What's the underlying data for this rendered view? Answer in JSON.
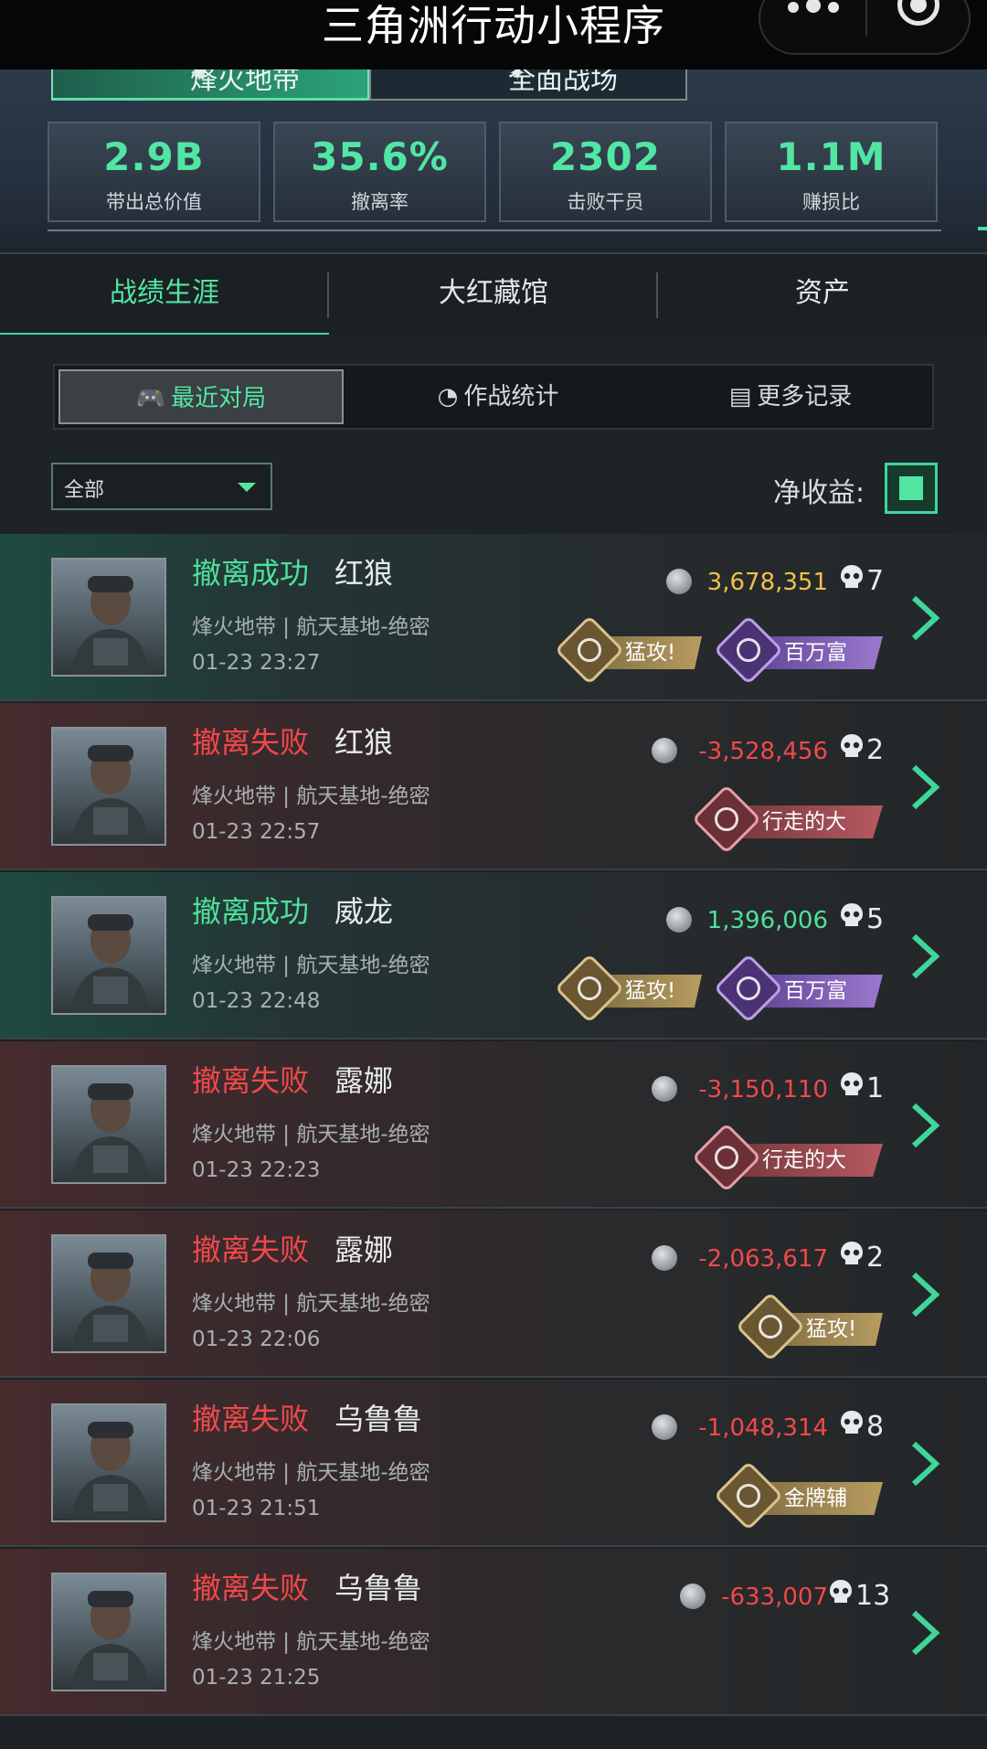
{
  "topbar": {
    "title": "三角洲行动小程序"
  },
  "mode_tabs": [
    {
      "label": "烽火地带"
    },
    {
      "label": "全面战场"
    }
  ],
  "stats": [
    {
      "value": "2.9B",
      "label": "带出总价值"
    },
    {
      "value": "35.6%",
      "label": "撤离率"
    },
    {
      "value": "2302",
      "label": "击败干员"
    },
    {
      "value": "1.1M",
      "label": "赚损比"
    }
  ],
  "main_tabs": [
    {
      "label": "战绩生涯"
    },
    {
      "label": "大红藏馆"
    },
    {
      "label": "资产"
    }
  ],
  "segments": [
    {
      "label": "最近对局",
      "icon": "gamepad-icon"
    },
    {
      "label": "作战统计",
      "icon": "pie-chart-icon"
    },
    {
      "label": "更多记录",
      "icon": "document-icon"
    }
  ],
  "filter": {
    "value": "全部"
  },
  "net_label": "净收益:",
  "colors": {
    "accent": "#52e6a3",
    "fail": "#f0494b",
    "gold": "#f0c04a"
  },
  "matches": [
    {
      "status": "撤离成功",
      "operator": "红狼",
      "map": "烽火地带 | 航天基地-绝密",
      "time": "01-23 23:27",
      "money": "3,678,351",
      "kills": "7",
      "badges": [
        {
          "label": "猛攻!",
          "style": "gold"
        },
        {
          "label": "百万富翁",
          "style": "purple"
        }
      ]
    },
    {
      "status": "撤离失败",
      "operator": "红狼",
      "map": "烽火地带 | 航天基地-绝密",
      "time": "01-23 22:57",
      "money": "-3,528,456",
      "kills": "2",
      "badges": [
        {
          "label": "行走的大红",
          "style": "red"
        }
      ]
    },
    {
      "status": "撤离成功",
      "operator": "威龙",
      "map": "烽火地带 | 航天基地-绝密",
      "time": "01-23 22:48",
      "money": "1,396,006",
      "kills": "5",
      "badges": [
        {
          "label": "猛攻!",
          "style": "gold"
        },
        {
          "label": "百万富翁",
          "style": "purple"
        }
      ]
    },
    {
      "status": "撤离失败",
      "operator": "露娜",
      "map": "烽火地带 | 航天基地-绝密",
      "time": "01-23 22:23",
      "money": "-3,150,110",
      "kills": "1",
      "badges": [
        {
          "label": "行走的大红",
          "style": "red"
        }
      ]
    },
    {
      "status": "撤离失败",
      "operator": "露娜",
      "map": "烽火地带 | 航天基地-绝密",
      "time": "01-23 22:06",
      "money": "-2,063,617",
      "kills": "2",
      "badges": [
        {
          "label": "猛攻!",
          "style": "gold"
        }
      ]
    },
    {
      "status": "撤离失败",
      "operator": "乌鲁鲁",
      "map": "烽火地带 | 航天基地-绝密",
      "time": "01-23 21:51",
      "money": "-1,048,314",
      "kills": "8",
      "badges": [
        {
          "label": "金牌辅助",
          "style": "gold"
        }
      ]
    },
    {
      "status": "撤离失败",
      "operator": "乌鲁鲁",
      "map": "烽火地带 | 航天基地-绝密",
      "time": "01-23 21:25",
      "money": "-633,007",
      "kills": "13",
      "badges": []
    }
  ]
}
